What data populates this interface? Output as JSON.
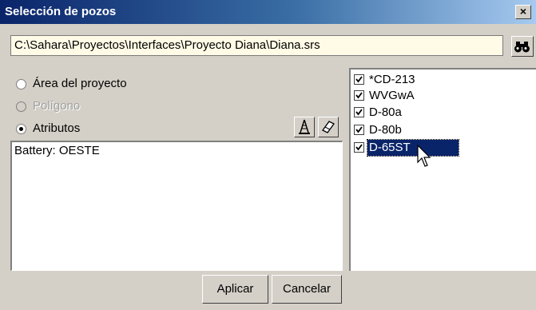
{
  "window": {
    "title": "Selección de pozos",
    "close_label": "×"
  },
  "project": {
    "path": "C:\\Sahara\\Proyectos\\Interfaces\\Proyecto Diana\\Diana.srs",
    "browse_icon": "binoculars-icon"
  },
  "selection_mode": {
    "options": [
      {
        "label": "Área del proyecto",
        "enabled": true,
        "selected": false
      },
      {
        "label": "Polígono",
        "enabled": false,
        "selected": false
      },
      {
        "label": "Atributos",
        "enabled": true,
        "selected": true
      }
    ]
  },
  "tools": {
    "well_tool_icon": "oil-derrick-icon",
    "eraser_icon": "eraser-icon"
  },
  "attributes": {
    "text": "Battery: OESTE"
  },
  "wells": [
    {
      "name": "*CD-213",
      "checked": true,
      "selected": false
    },
    {
      "name": "WVGwA",
      "checked": true,
      "selected": false
    },
    {
      "name": "D-80a",
      "checked": true,
      "selected": false
    },
    {
      "name": "D-80b",
      "checked": true,
      "selected": false
    },
    {
      "name": "D-65ST",
      "checked": true,
      "selected": true
    }
  ],
  "actions": {
    "apply_label": "Aplicar",
    "cancel_label": "Cancelar"
  },
  "colors": {
    "title_start": "#0a246a",
    "title_end": "#a6caf0",
    "selection": "#0a246a",
    "path_bg": "#fffbe6",
    "dialog_bg": "#d4d0c8"
  }
}
